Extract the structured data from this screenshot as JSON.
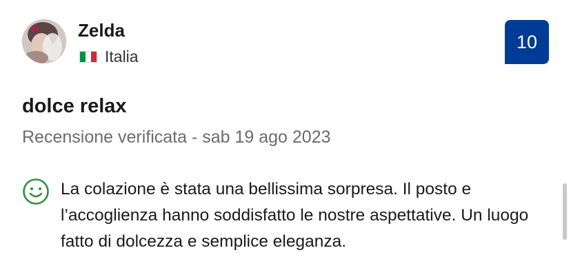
{
  "reviewer": {
    "name": "Zelda",
    "country": "Italia",
    "flag_colors": [
      "#009246",
      "#ffffff",
      "#ce2b37"
    ]
  },
  "score": "10",
  "score_color": "#003b95",
  "review": {
    "title": "dolce relax",
    "meta": "Recensione verificata - sab 19 ago 2023",
    "positive_icon": "smile-icon",
    "positive_color": "#2f8f3a",
    "positive_text": "La colazione è stata una bellissima sorpresa. Il posto e l’accoglienza hanno soddisfatto le nostre aspettative. Un luogo fatto di dolcezza e semplice eleganza."
  }
}
